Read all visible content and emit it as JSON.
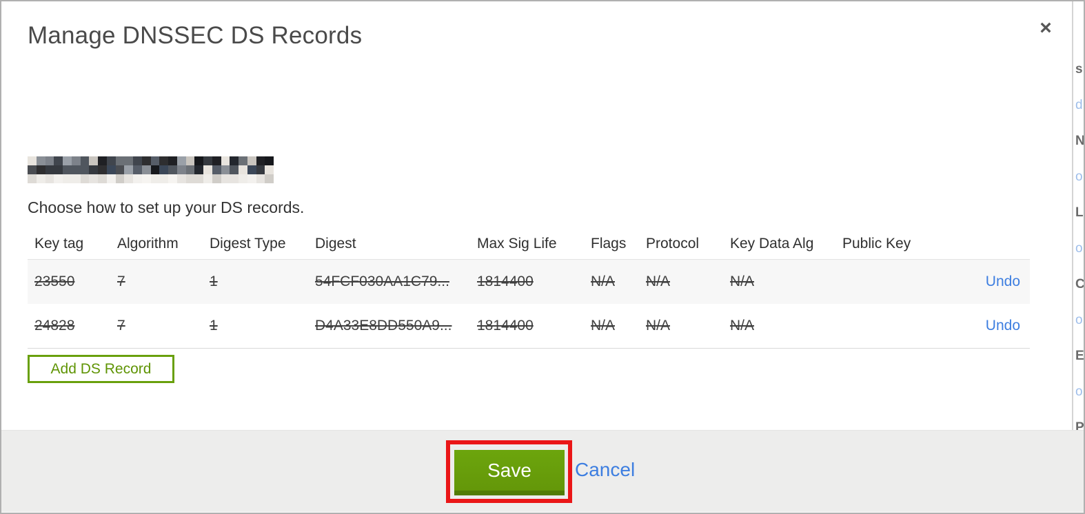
{
  "modal": {
    "title": "Manage DNSSEC DS Records",
    "close_icon": "×",
    "subtitle": "Choose how to set up your DS records.",
    "domain_name_redacted": "pixelated-redacted-domain",
    "table": {
      "columns": [
        "Key tag",
        "Algorithm",
        "Digest Type",
        "Digest",
        "Max Sig Life",
        "Flags",
        "Protocol",
        "Key Data Alg",
        "Public Key"
      ],
      "rows": [
        {
          "key_tag": "23550",
          "algorithm": "7",
          "digest_type": "1",
          "digest": "54FCF030AA1C79...",
          "max_sig_life": "1814400",
          "flags": "N/A",
          "protocol": "N/A",
          "key_data_alg": "N/A",
          "public_key": "",
          "action": "Undo",
          "marked_deleted": true
        },
        {
          "key_tag": "24828",
          "algorithm": "7",
          "digest_type": "1",
          "digest": "D4A33E8DD550A9...",
          "max_sig_life": "1814400",
          "flags": "N/A",
          "protocol": "N/A",
          "key_data_alg": "N/A",
          "public_key": "",
          "action": "Undo",
          "marked_deleted": true
        }
      ]
    },
    "add_button_label": "Add DS Record",
    "footer": {
      "save_label": "Save",
      "cancel_label": "Cancel"
    }
  },
  "annotation": {
    "type": "highlight-box",
    "target": "save-button",
    "color": "#ea1617"
  },
  "colors": {
    "save_button_green": "#669a0a",
    "save_button_edge": "#527c05",
    "add_button_green": "#69a00c",
    "link_blue": "#3d7ee0",
    "footer_gray": "#ededec",
    "row_alt_gray": "#f7f7f7",
    "title_gray": "#4a4a4a"
  },
  "background_sliver": {
    "fragments": [
      "s",
      "d",
      "N",
      "o",
      "L",
      "o",
      "C",
      "o",
      "E",
      "o",
      "P"
    ]
  }
}
